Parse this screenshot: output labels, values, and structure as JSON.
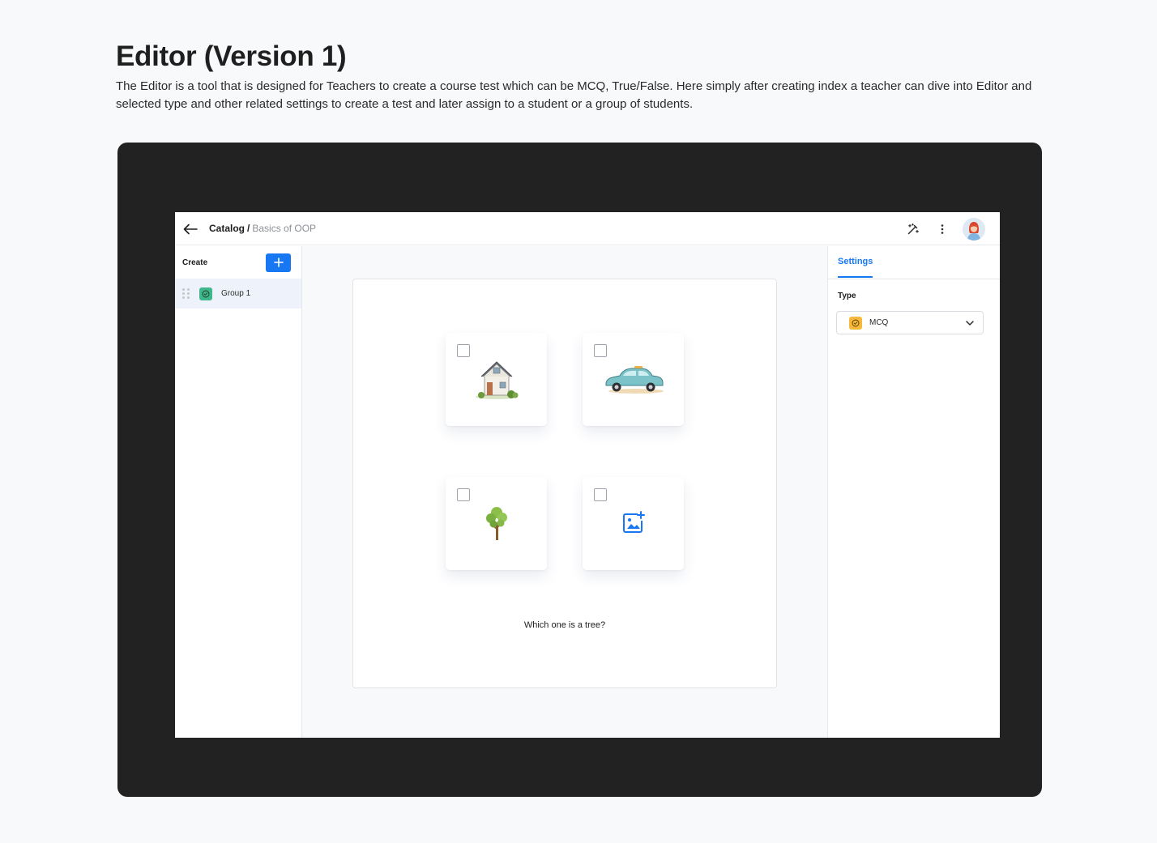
{
  "page": {
    "title": "Editor (Version 1)",
    "description": "The Editor is a tool that is designed for Teachers to create a course test which can be MCQ, True/False. Here simply after creating index a teacher can dive into Editor and selected type and other related settings to create a test and later assign to a student or a group of students."
  },
  "topbar": {
    "breadcrumb_root": "Catalog",
    "breadcrumb_separator": "/",
    "breadcrumb_current": "Basics of OOP",
    "icons": [
      "back-arrow-icon",
      "magic-wand-icon",
      "more-vertical-icon",
      "avatar"
    ]
  },
  "sidebar": {
    "create_label": "Create",
    "add_icon": "plus-icon",
    "items": [
      {
        "label": "Group 1",
        "icon": "check-circle-icon",
        "color": "#3fb68b",
        "selected": true
      }
    ]
  },
  "editor": {
    "options": [
      {
        "image": "house",
        "checked": false
      },
      {
        "image": "car",
        "checked": false
      },
      {
        "image": "tree",
        "checked": false
      },
      {
        "image": "add-image-icon",
        "checked": false
      }
    ],
    "question": "Which one is a tree?"
  },
  "settings": {
    "tab_label": "Settings",
    "type_label": "Type",
    "type_value": "MCQ",
    "type_color": "#f6b93b"
  },
  "colors": {
    "accent": "#1877f2",
    "frame": "#222222",
    "background": "#f8f9fb"
  }
}
